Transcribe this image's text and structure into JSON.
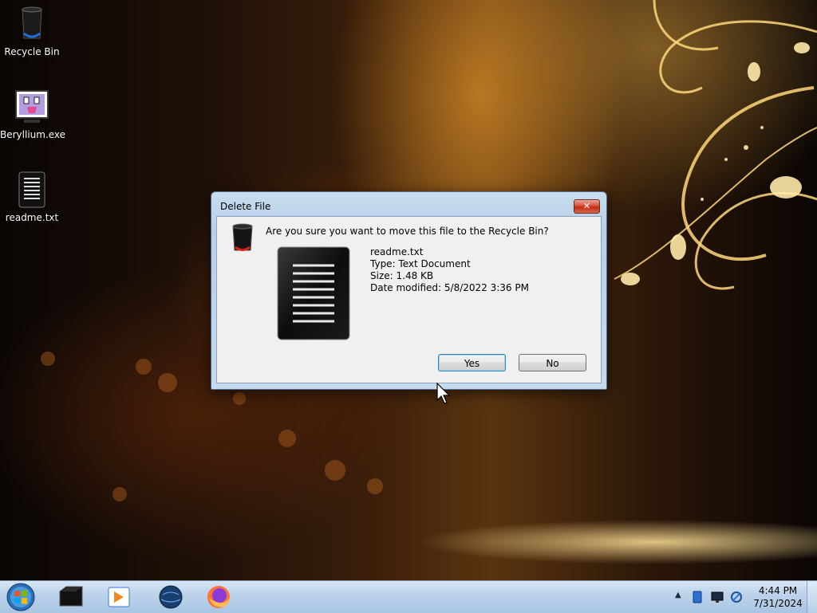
{
  "desktop": {
    "icons": [
      {
        "label": "Recycle Bin",
        "icon": "recycle-bin-icon"
      },
      {
        "label": "Beryllium.exe",
        "icon": "app-icon"
      },
      {
        "label": "readme.txt",
        "icon": "text-file-icon"
      }
    ]
  },
  "dialog": {
    "title": "Delete File",
    "close_label": "✕",
    "question": "Are you sure you want to move this file to the Recycle Bin?",
    "file": {
      "name": "readme.txt",
      "type": "Type: Text Document",
      "size": "Size: 1.48 KB",
      "modified": "Date modified: 5/8/2022 3:36 PM"
    },
    "buttons": {
      "yes": "Yes",
      "no": "No"
    }
  },
  "taskbar": {
    "pinned": [
      "terminal-icon",
      "media-player-icon",
      "globe-icon",
      "firefox-icon"
    ],
    "tray_chevron": "▲",
    "tray_icons": [
      "tablet-icon",
      "monitor-icon",
      "network-icon"
    ],
    "clock": {
      "time": "4:44 PM",
      "date": "7/31/2024"
    }
  },
  "colors": {
    "accent": "#3c7fb1",
    "close": "#c42c12"
  }
}
